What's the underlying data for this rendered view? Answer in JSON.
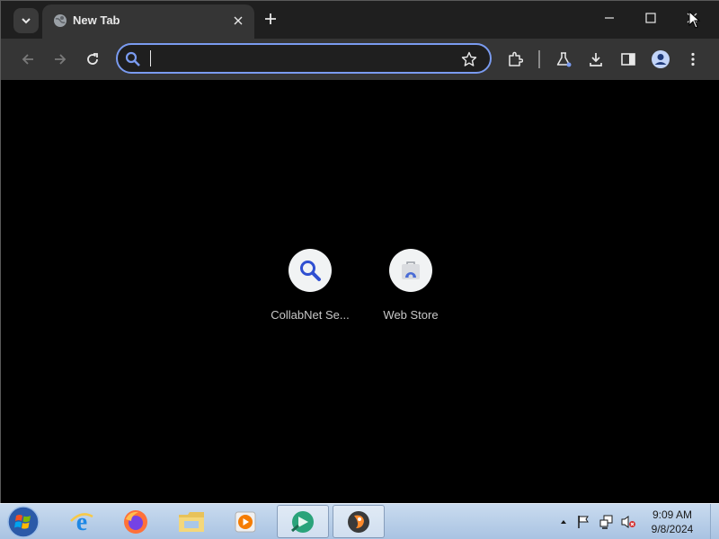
{
  "browser": {
    "tab": {
      "title": "New Tab",
      "favicon": "globe-icon"
    },
    "omnibox": {
      "value": "",
      "placeholder": ""
    },
    "accent_color": "#7a9bf0",
    "toolbar_icons": [
      "back-arrow-icon",
      "forward-arrow-icon",
      "reload-icon",
      "star-icon",
      "extensions-icon",
      "labs-flask-icon",
      "download-icon",
      "side-panel-icon",
      "profile-icon",
      "menu-dots-icon"
    ]
  },
  "shortcuts": [
    {
      "label": "CollabNet Se...",
      "icon": "search-icon"
    },
    {
      "label": "Web Store",
      "icon": "web-store-icon"
    }
  ],
  "taskbar": {
    "apps": [
      "internet-explorer-icon",
      "firefox-icon",
      "file-explorer-icon",
      "media-player-icon",
      "app-green-icon",
      "app-orange-icon"
    ],
    "tray_icons": [
      "show-hidden-icons",
      "action-center-flag-icon",
      "network-icon",
      "volume-muted-icon"
    ],
    "clock": {
      "time": "9:09 AM",
      "date": "9/8/2024"
    }
  }
}
